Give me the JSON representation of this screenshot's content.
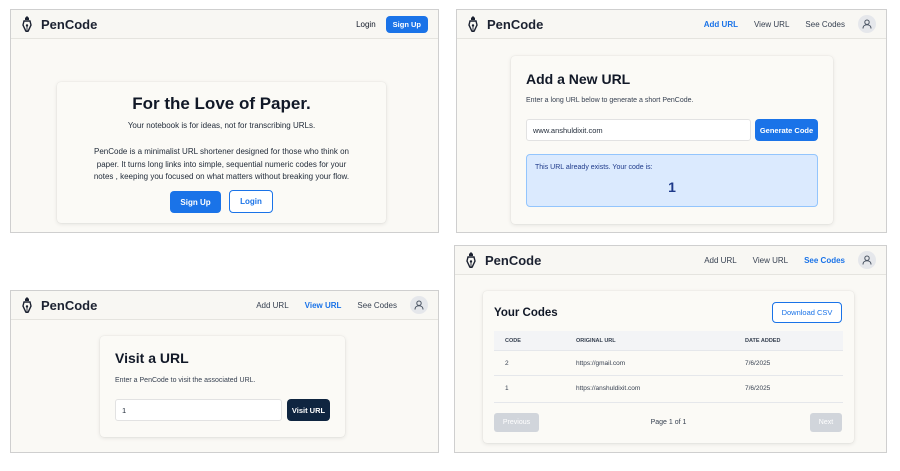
{
  "brand": {
    "name": "PenCode"
  },
  "landing": {
    "nav": {
      "login": "Login",
      "signup": "Sign Up"
    },
    "title": "For the Love of Paper.",
    "subtitle": "Your notebook is for ideas, not for transcribing URLs.",
    "description_lines": [
      "PenCode is a minimalist URL shortener designed for those who think on",
      "paper. It turns long links into simple, sequential numeric codes for your",
      "notes , keeping you focused on what matters without breaking your flow."
    ],
    "signup_button": "Sign Up",
    "login_button": "Login"
  },
  "add_url": {
    "nav": {
      "add": "Add URL",
      "view": "View URL",
      "see": "See Codes"
    },
    "title": "Add a New URL",
    "instruction": "Enter a long URL below to generate a short PenCode.",
    "input_value": "www.anshuldixit.com",
    "generate_button": "Generate Code",
    "message": "This URL already exists. Your code is:",
    "code": "1"
  },
  "visit_url": {
    "nav": {
      "add": "Add URL",
      "view": "View URL",
      "see": "See Codes"
    },
    "title": "Visit a URL",
    "instruction": "Enter a PenCode to visit the associated URL.",
    "input_value": "1",
    "visit_button": "Visit URL"
  },
  "codes": {
    "nav": {
      "add": "Add URL",
      "view": "View URL",
      "see": "See Codes"
    },
    "title": "Your Codes",
    "download_button": "Download CSV",
    "headers": {
      "code": "CODE",
      "url": "ORIGINAL URL",
      "date": "DATE ADDED"
    },
    "rows": [
      {
        "code": "2",
        "url": "https://gmail.com",
        "date": "7/6/2025"
      },
      {
        "code": "1",
        "url": "https://anshuldixit.com",
        "date": "7/6/2025"
      }
    ],
    "previous_button": "Previous",
    "page_info": "Page 1 of 1",
    "next_button": "Next"
  },
  "colors": {
    "accent": "#1a73e8",
    "dark_button": "#0f2540",
    "info_bg": "#dbeafe"
  }
}
